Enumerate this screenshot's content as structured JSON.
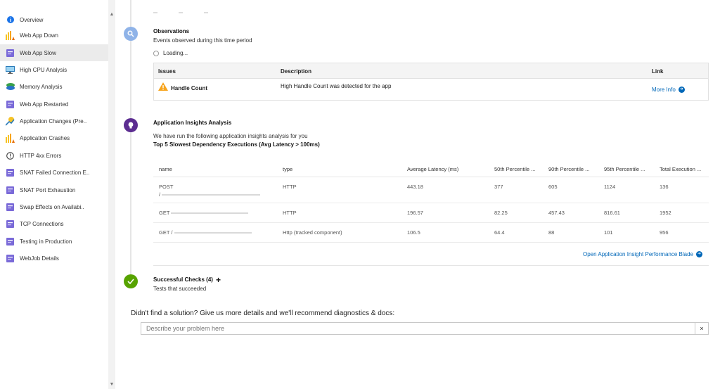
{
  "sidebar": {
    "items": [
      {
        "label": "Overview",
        "icon": "info-icon",
        "active": false
      },
      {
        "label": "Web App Down",
        "icon": "bar-chart-warning-icon",
        "active": false
      },
      {
        "label": "Web App Slow",
        "icon": "app-blade-icon",
        "active": true
      },
      {
        "label": "High CPU Analysis",
        "icon": "monitor-icon",
        "active": false
      },
      {
        "label": "Memory Analysis",
        "icon": "memory-icon",
        "active": false
      },
      {
        "label": "Web App Restarted",
        "icon": "app-blade-icon",
        "active": false
      },
      {
        "label": "Application Changes (Pre..",
        "icon": "change-analysis-icon",
        "active": false
      },
      {
        "label": "Application Crashes",
        "icon": "bar-chart-warning-icon",
        "active": false
      },
      {
        "label": "HTTP 4xx Errors",
        "icon": "alert-circle-icon",
        "active": false
      },
      {
        "label": "SNAT Failed Connection E..",
        "icon": "app-blade-icon",
        "active": false
      },
      {
        "label": "SNAT Port Exhaustion",
        "icon": "app-blade-icon",
        "active": false
      },
      {
        "label": "Swap Effects on Availabi..",
        "icon": "app-blade-icon",
        "active": false
      },
      {
        "label": "TCP Connections",
        "icon": "app-blade-icon",
        "active": false
      },
      {
        "label": "Testing in Production",
        "icon": "app-blade-icon",
        "active": false
      },
      {
        "label": "WebJob Details",
        "icon": "app-blade-icon",
        "active": false
      }
    ]
  },
  "observations": {
    "title": "Observations",
    "subtitle": "Events observed during this time period",
    "loading": "Loading...",
    "table": {
      "headers": {
        "issues": "Issues",
        "description": "Description",
        "link": "Link"
      },
      "rows": [
        {
          "issue": "Handle Count",
          "description": "High Handle Count was detected for the app",
          "link": "More Info"
        }
      ]
    }
  },
  "insights": {
    "title": "Application Insights Analysis",
    "subtitle": "We have run the following application insights analysis for you",
    "section_title": "Top 5 Slowest Dependency Executions (Avg Latency > 100ms)",
    "table": {
      "headers": [
        "name",
        "type",
        "Average Latency (ms)",
        "50th Percentile ...",
        "90th Percentile ...",
        "95th Percentile ...",
        "Total Execution ..."
      ],
      "rows": [
        {
          "name": "POST",
          "name2": "/",
          "type": "HTTP",
          "avg": "443.18",
          "p50": "377",
          "p90": "605",
          "p95": "1124",
          "total": "136"
        },
        {
          "name": "GET",
          "name2": "",
          "type": "HTTP",
          "avg": "196.57",
          "p50": "82.25",
          "p90": "457.43",
          "p95": "816.61",
          "total": "1952"
        },
        {
          "name": "GET /",
          "name2": "",
          "type": "Http (tracked component)",
          "avg": "106.5",
          "p50": "64.4",
          "p90": "88",
          "p95": "101",
          "total": "956"
        }
      ]
    },
    "open_blade": "Open Application Insight Performance Blade"
  },
  "successful": {
    "title": "Successful Checks (4)",
    "subtitle": "Tests that succeeded"
  },
  "feedback": {
    "prompt": "Didn't find a solution? Give us more details and we'll recommend diagnostics & docs:",
    "placeholder": "Describe your problem here",
    "clear": "×"
  },
  "colors": {
    "observations_circle": "#8fb3e8",
    "insights_circle": "#5c2d91",
    "success_circle": "#57a300",
    "link": "#0067b8",
    "warning": "#f7a41d"
  }
}
